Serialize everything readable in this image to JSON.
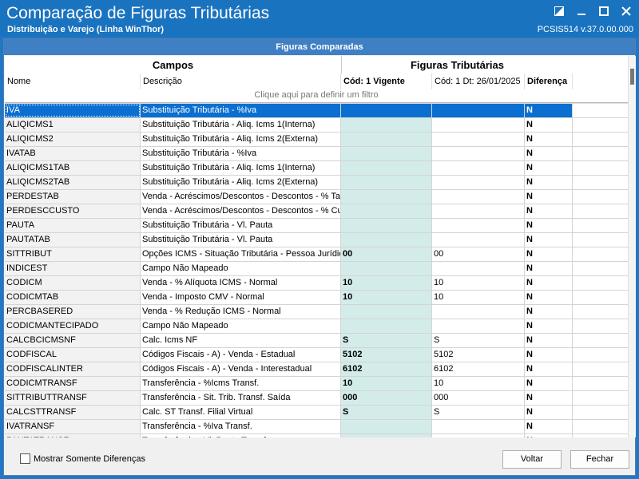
{
  "window": {
    "title": "Comparação de Figuras Tributárias",
    "subtitle": "Distribuição e Varejo (Linha WinThor)",
    "version": "PCSIS514  v.37.0.00.000",
    "icons": [
      "restore-icon",
      "minimize-icon",
      "maximize-icon",
      "close-icon"
    ]
  },
  "panel": {
    "header": "Figuras Comparadas"
  },
  "grid": {
    "band_campos": "Campos",
    "band_figuras": "Figuras Tributárias",
    "columns": {
      "nome": "Nome",
      "descricao": "Descrição",
      "vigente": "Cód: 1 Vigente",
      "data": "Cód: 1 Dt: 26/01/2025",
      "diferenca": "Diferença"
    },
    "filter_hint": "Clique aqui para definir um filtro",
    "rows": [
      {
        "nome": "IVA",
        "descricao": "Substituição Tributária - %Iva",
        "vigente": "",
        "data": "",
        "diferenca": "N"
      },
      {
        "nome": "ALIQICMS1",
        "descricao": "Substituição Tributária - Aliq. Icms 1(Interna)",
        "vigente": "",
        "data": "",
        "diferenca": "N"
      },
      {
        "nome": "ALIQICMS2",
        "descricao": "Substituição Tributária - Aliq. Icms 2(Externa)",
        "vigente": "",
        "data": "",
        "diferenca": "N"
      },
      {
        "nome": "IVATAB",
        "descricao": "Substituição Tributária - %Iva",
        "vigente": "",
        "data": "",
        "diferenca": "N"
      },
      {
        "nome": "ALIQICMS1TAB",
        "descricao": "Substituição Tributária - Aliq. Icms 1(Interna)",
        "vigente": "",
        "data": "",
        "diferenca": "N"
      },
      {
        "nome": "ALIQICMS2TAB",
        "descricao": "Substituição Tributária - Aliq. Icms 2(Externa)",
        "vigente": "",
        "data": "",
        "diferenca": "N"
      },
      {
        "nome": "PERDESTAB",
        "descricao": "Venda - Acréscimos/Descontos - Descontos - % Tab",
        "vigente": "",
        "data": "",
        "diferenca": "N"
      },
      {
        "nome": "PERDESCCUSTO",
        "descricao": "Venda - Acréscimos/Descontos - Descontos - % Cus",
        "vigente": "",
        "data": "",
        "diferenca": "N"
      },
      {
        "nome": "PAUTA",
        "descricao": "Substituição Tributária - Vl. Pauta",
        "vigente": "",
        "data": "",
        "diferenca": "N"
      },
      {
        "nome": "PAUTATAB",
        "descricao": "Substituição Tributária - Vl. Pauta",
        "vigente": "",
        "data": "",
        "diferenca": "N"
      },
      {
        "nome": "SITTRIBUT",
        "descricao": "Opções ICMS - Situação Tributária - Pessoa Jurídica",
        "vigente": "00",
        "data": "00",
        "diferenca": "N"
      },
      {
        "nome": "INDICEST",
        "descricao": "Campo Não Mapeado",
        "vigente": "",
        "data": "",
        "diferenca": "N"
      },
      {
        "nome": "CODICM",
        "descricao": "Venda - % Alíquota ICMS - Normal",
        "vigente": "10",
        "data": "10",
        "diferenca": "N"
      },
      {
        "nome": "CODICMTAB",
        "descricao": "Venda - Imposto CMV - Normal",
        "vigente": "10",
        "data": "10",
        "diferenca": "N"
      },
      {
        "nome": "PERCBASERED",
        "descricao": "Venda - % Redução ICMS - Normal",
        "vigente": "",
        "data": "",
        "diferenca": "N"
      },
      {
        "nome": "CODICMANTECIPADO",
        "descricao": "Campo Não Mapeado",
        "vigente": "",
        "data": "",
        "diferenca": "N"
      },
      {
        "nome": "CALCBCICMSNF",
        "descricao": "Calc. Icms NF",
        "vigente": "S",
        "data": "S",
        "diferenca": "N"
      },
      {
        "nome": "CODFISCAL",
        "descricao": "Códigos Fiscais - A) - Venda - Estadual",
        "vigente": "5102",
        "data": "5102",
        "diferenca": "N"
      },
      {
        "nome": "CODFISCALINTER",
        "descricao": "Códigos Fiscais - A) - Venda - Interestadual",
        "vigente": "6102",
        "data": "6102",
        "diferenca": "N"
      },
      {
        "nome": "CODICMTRANSF",
        "descricao": "Transferência - %Icms Transf.",
        "vigente": "10",
        "data": "10",
        "diferenca": "N"
      },
      {
        "nome": "SITTRIBUTTRANSF",
        "descricao": "Transferência - Sit. Trib. Transf. Saída",
        "vigente": "000",
        "data": "000",
        "diferenca": "N"
      },
      {
        "nome": "CALCSTTRANSF",
        "descricao": "Calc. ST Transf. Filial Virtual",
        "vigente": "S",
        "data": "S",
        "diferenca": "N"
      },
      {
        "nome": "IVATRANSF",
        "descricao": "Transferência - %Iva Transf.",
        "vigente": "",
        "data": "",
        "diferenca": "N"
      },
      {
        "nome": "PAUTATRANSF",
        "descricao": "Transferência - Vl. Pauta Transf.",
        "vigente": "",
        "data": "",
        "diferenca": "N"
      }
    ]
  },
  "footer": {
    "checkbox_label": "Mostrar Somente Diferenças",
    "voltar": "Voltar",
    "fechar": "Fechar"
  },
  "colors": {
    "titlebar": "#1a73bf",
    "selected_row": "#0a6fd1",
    "vigente_column": "#d3ecea"
  }
}
